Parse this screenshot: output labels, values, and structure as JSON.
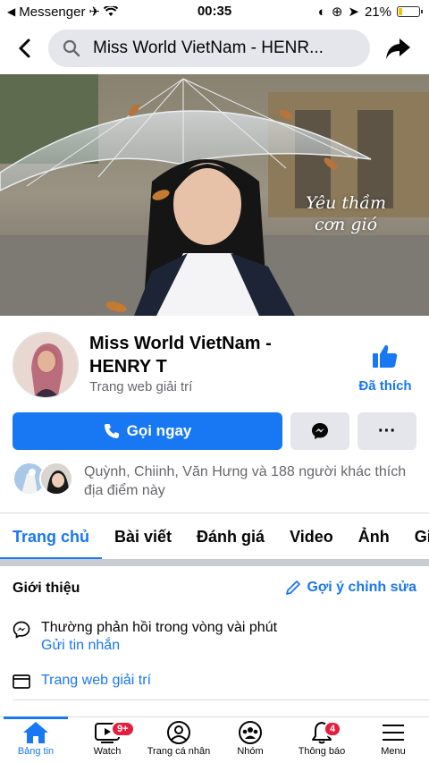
{
  "status_bar": {
    "back_app": "Messenger",
    "time": "00:35",
    "battery": "21%",
    "battery_level": 0.21
  },
  "header": {
    "search_text": "Miss World VietNam - HENR..."
  },
  "cover": {
    "overlay_text": "Yêu thầm cơn gió"
  },
  "profile": {
    "name": "Miss World VietNam - HENRY T",
    "category": "Trang web giải trí",
    "liked_label": "Đã thích"
  },
  "actions": {
    "call_label": "Gọi ngay",
    "more_label": "···"
  },
  "friends": {
    "text": "Quỳnh, Chiinh, Văn Hưng và 188 người khác thích địa điểm này"
  },
  "tabs": [
    {
      "label": "Trang chủ"
    },
    {
      "label": "Bài viết"
    },
    {
      "label": "Đánh giá"
    },
    {
      "label": "Video"
    },
    {
      "label": "Ảnh"
    },
    {
      "label": "Giới"
    }
  ],
  "intro": {
    "title": "Giới thiệu",
    "suggest_label": "Gợi ý chỉnh sửa",
    "response_text": "Thường phản hồi trong vòng vài phút",
    "send_message_label": "Gửi tin nhắn",
    "category_link": "Trang web giải trí"
  },
  "bottom_nav": [
    {
      "label": "Bảng tin",
      "icon": "home-icon"
    },
    {
      "label": "Watch",
      "icon": "watch-icon",
      "badge": "9+"
    },
    {
      "label": "Trang cá nhân",
      "icon": "profile-icon"
    },
    {
      "label": "Nhóm",
      "icon": "groups-icon"
    },
    {
      "label": "Thông báo",
      "icon": "bell-icon",
      "badge": "4"
    },
    {
      "label": "Menu",
      "icon": "menu-icon"
    }
  ],
  "colors": {
    "accent": "#1877f2",
    "badge": "#e41e3f"
  }
}
